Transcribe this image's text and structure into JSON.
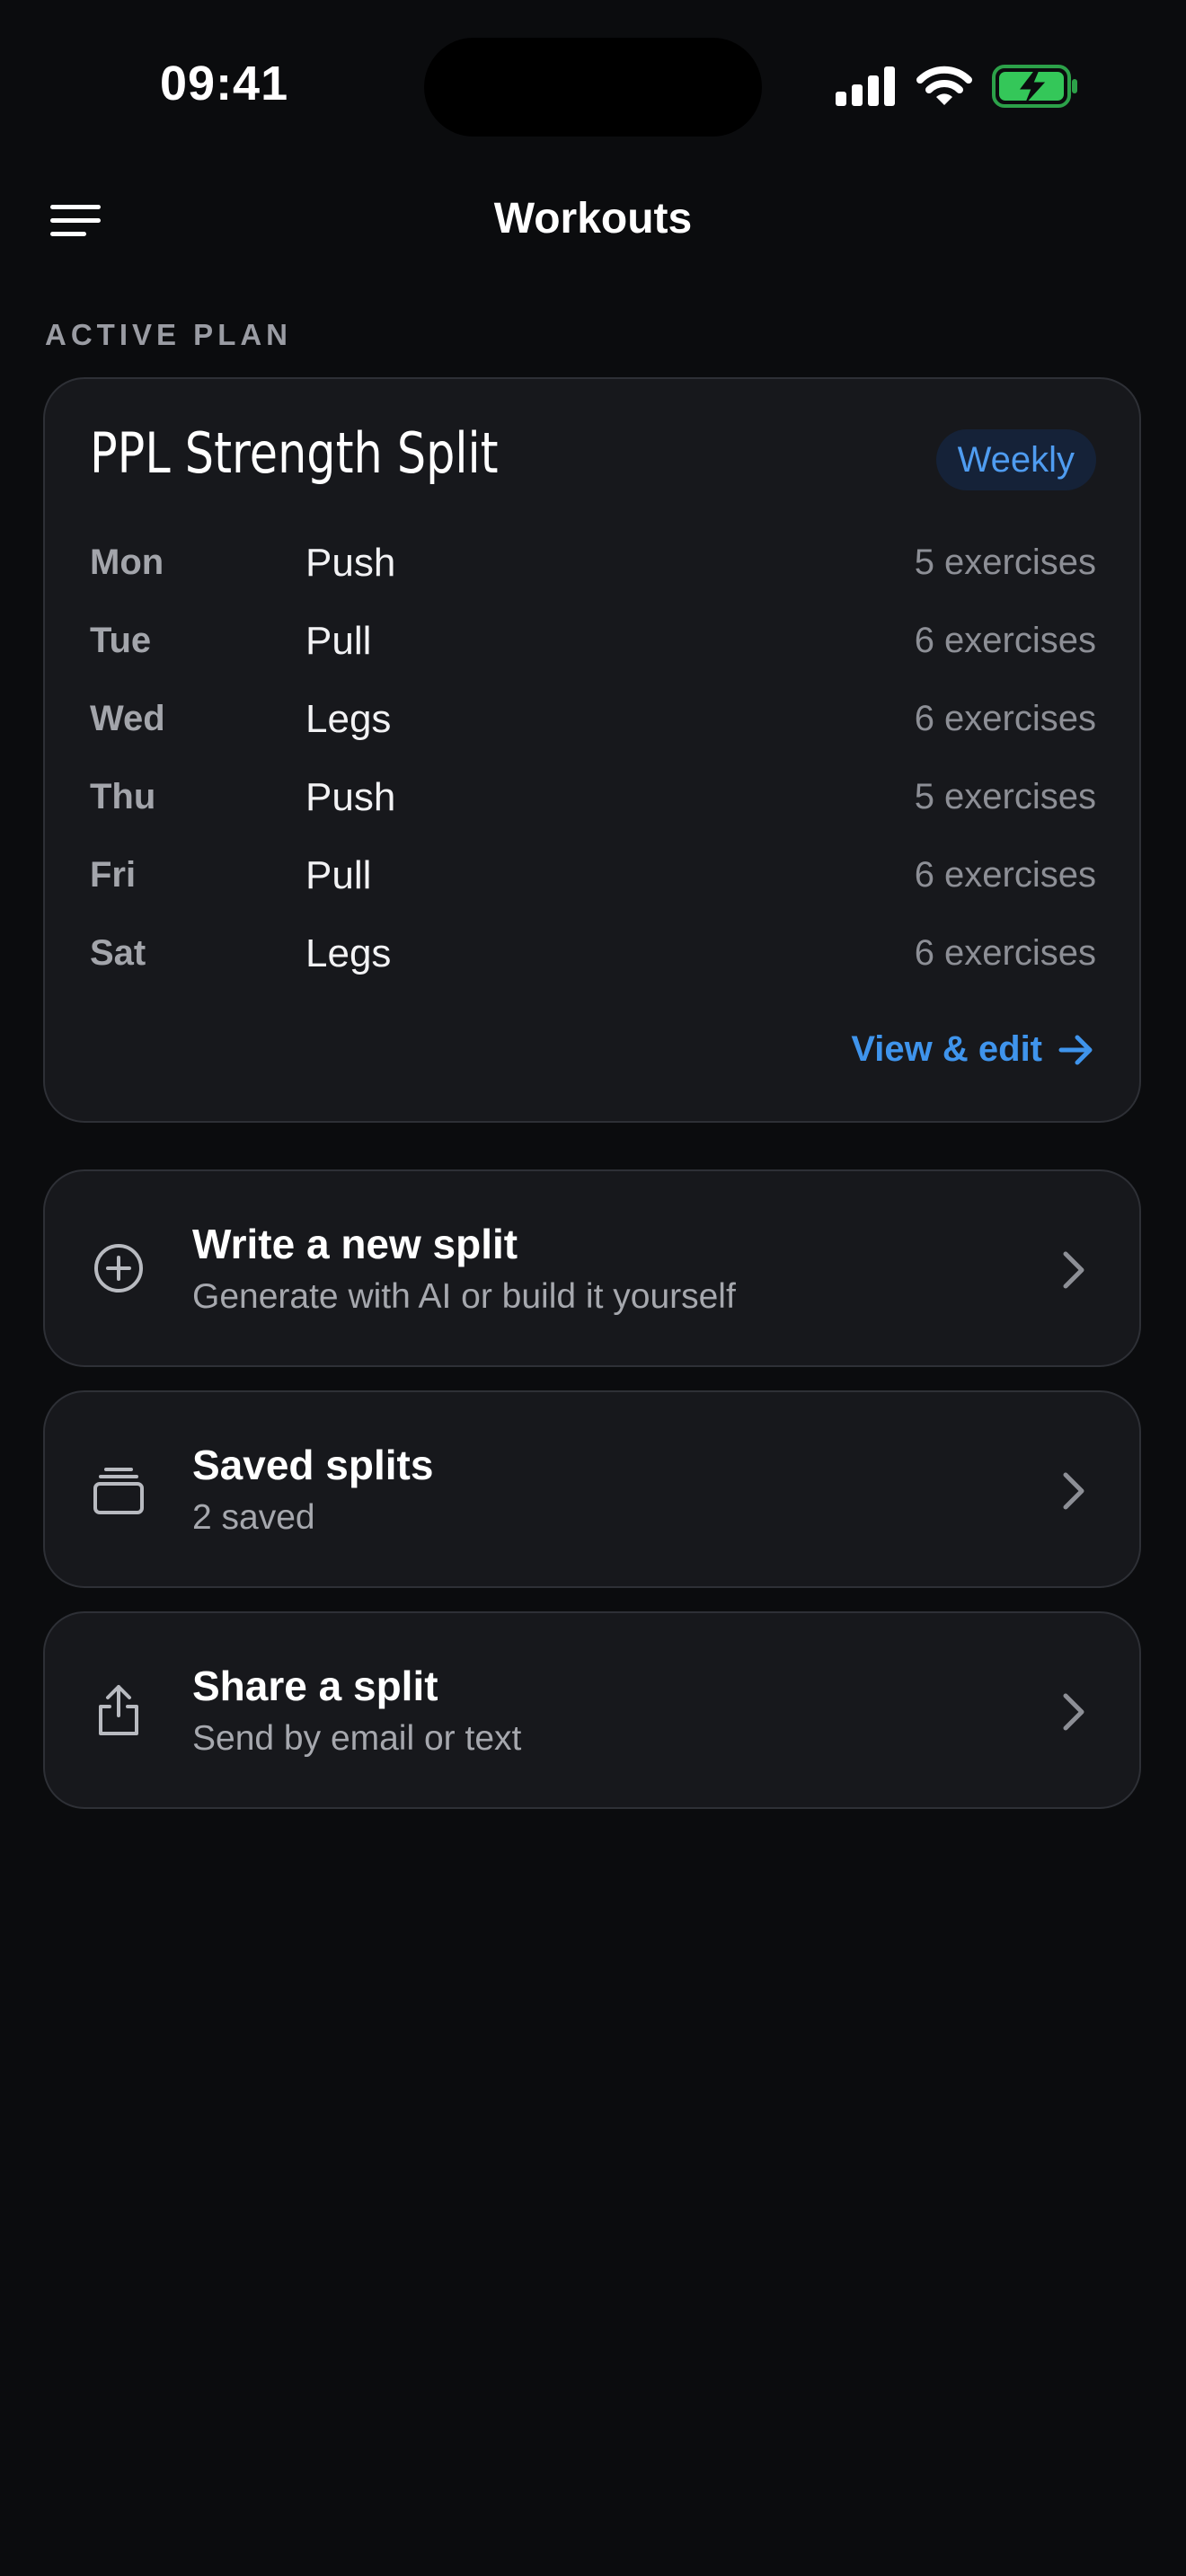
{
  "status_bar": {
    "time": "09:41"
  },
  "nav": {
    "title": "Workouts",
    "menu_icon": "hamburger-menu-icon"
  },
  "section_label": "ACTIVE PLAN",
  "active_plan": {
    "name": "PPL Strength Split",
    "frequency_badge": "Weekly",
    "schedule": [
      {
        "day": "Mon",
        "workout": "Push",
        "count": "5 exercises"
      },
      {
        "day": "Tue",
        "workout": "Pull",
        "count": "6 exercises"
      },
      {
        "day": "Wed",
        "workout": "Legs",
        "count": "6 exercises"
      },
      {
        "day": "Thu",
        "workout": "Push",
        "count": "5 exercises"
      },
      {
        "day": "Fri",
        "workout": "Pull",
        "count": "6 exercises"
      },
      {
        "day": "Sat",
        "workout": "Legs",
        "count": "6 exercises"
      }
    ],
    "view_edit_label": "View & edit"
  },
  "actions": [
    {
      "title": "Write a new split",
      "subtitle": "Generate with AI or build it yourself",
      "icon": "plus-circle-icon"
    },
    {
      "title": "Saved splits",
      "subtitle": "2 saved",
      "icon": "stack-icon"
    },
    {
      "title": "Share a split",
      "subtitle": "Send by email or text",
      "icon": "share-icon"
    }
  ],
  "colors": {
    "background": "#0b0c0e",
    "card": "#17181c",
    "accent": "#3f94ec",
    "battery": "#34c759"
  }
}
